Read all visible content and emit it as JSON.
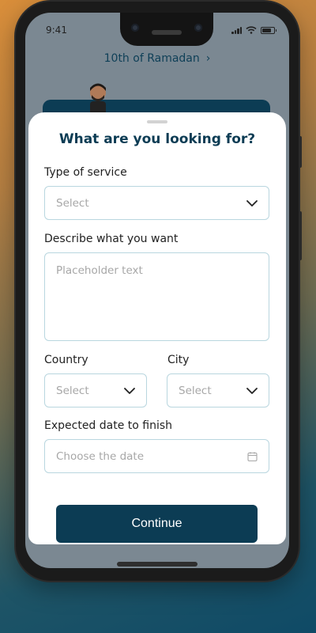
{
  "status_bar": {
    "time": "9:41"
  },
  "header": {
    "location": "10th of Ramadan",
    "chevron": "›"
  },
  "sheet": {
    "title": "What are you looking for?",
    "service": {
      "label": "Type of service",
      "placeholder": "Select"
    },
    "description": {
      "label": "Describe what you want",
      "placeholder": "Placeholder text"
    },
    "country": {
      "label": "Country",
      "placeholder": "Select"
    },
    "city": {
      "label": "City",
      "placeholder": "Select"
    },
    "date": {
      "label": "Expected date to finish",
      "placeholder": "Choose the date"
    },
    "continue_label": "Continue"
  },
  "colors": {
    "primary": "#0c3c54",
    "field_border": "#b9d6df",
    "placeholder": "#a7a7a7"
  },
  "icons": [
    "chevron-right-icon",
    "chevron-down-icon",
    "calendar-icon",
    "signal-icon",
    "wifi-icon",
    "battery-icon"
  ]
}
